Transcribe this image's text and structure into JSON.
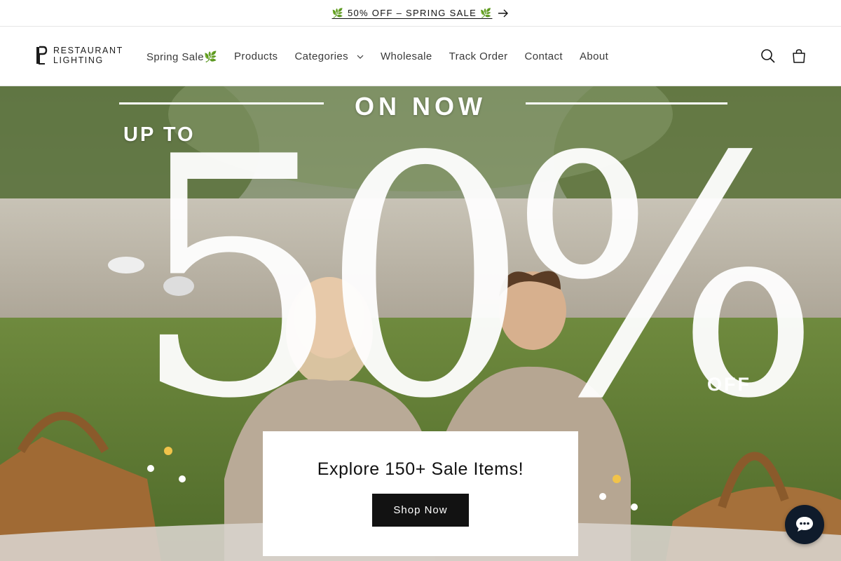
{
  "announcement": {
    "text": "🌿 50% OFF – SPRING SALE 🌿",
    "arrow_icon": "arrow-right-icon"
  },
  "header": {
    "logo": {
      "line1": "RESTAURANT",
      "line2": "LIGHTING"
    },
    "nav": [
      {
        "label": "Spring Sale🌿"
      },
      {
        "label": "Products"
      },
      {
        "label": "Categories",
        "has_dropdown": true
      },
      {
        "label": "Wholesale"
      },
      {
        "label": "Track Order"
      },
      {
        "label": "Contact"
      },
      {
        "label": "About"
      }
    ],
    "icons": {
      "search": "search-icon",
      "cart": "cart-icon",
      "dropdown": "chevron-down-icon"
    }
  },
  "hero": {
    "on_now": "ON NOW",
    "up_to": "UP TO",
    "big": "50%",
    "off": "OFF",
    "card_title": "Explore 150+ Sale Items!",
    "cta": "Shop Now"
  },
  "chat": {
    "icon": "chat-bubble-icon"
  },
  "colors": {
    "text": "#121212",
    "button": "#121212",
    "chat": "#0f1b2b",
    "background": "#ffffff"
  }
}
